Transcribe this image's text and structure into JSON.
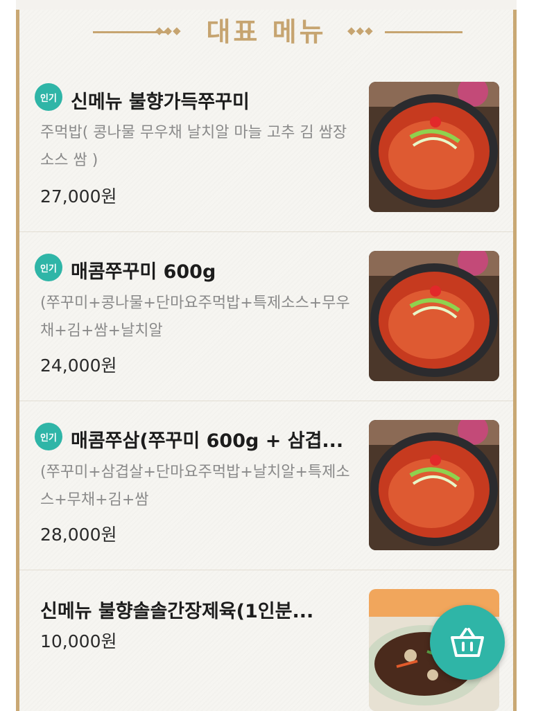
{
  "header": {
    "title": "대표 메뉴",
    "ornament_left": "◆◆◆",
    "ornament_right": "◆◆◆"
  },
  "menu": {
    "items": [
      {
        "badge": "인기",
        "name": "신메뉴 불향가득쭈꾸미",
        "desc": "주먹밥( 콩나물 무우채 날치알 마늘 고추 김 쌈장 소스  쌈 )",
        "price": "27,000원",
        "image": "spicy-webfoot-octopus-dish"
      },
      {
        "badge": "인기",
        "name": "매콤쭈꾸미 600g",
        "desc": "(쭈꾸미+콩나물+단마요주먹밥+특제소스+무우채+김+쌈+날치알",
        "price": "24,000원",
        "image": "spicy-webfoot-octopus-dish"
      },
      {
        "badge": "인기",
        "name": "매콤쭈삼(쭈꾸미 600g + 삼겹...",
        "desc": "(쭈꾸미+삼겹살+단마요주먹밥+날치알+특제소스+무채+김+쌈",
        "price": "28,000원",
        "image": "spicy-webfoot-octopus-dish"
      },
      {
        "badge": "",
        "name": "신메뉴 불향솔솔간장제육(1인분...",
        "desc": "",
        "price": "10,000원",
        "image": "soy-sauce-pork-dish"
      }
    ]
  },
  "colors": {
    "accent": "#2fb5a7",
    "gold": "#c6a470",
    "background": "#f6f5f1"
  },
  "cart_button": {
    "icon": "basket-icon"
  }
}
